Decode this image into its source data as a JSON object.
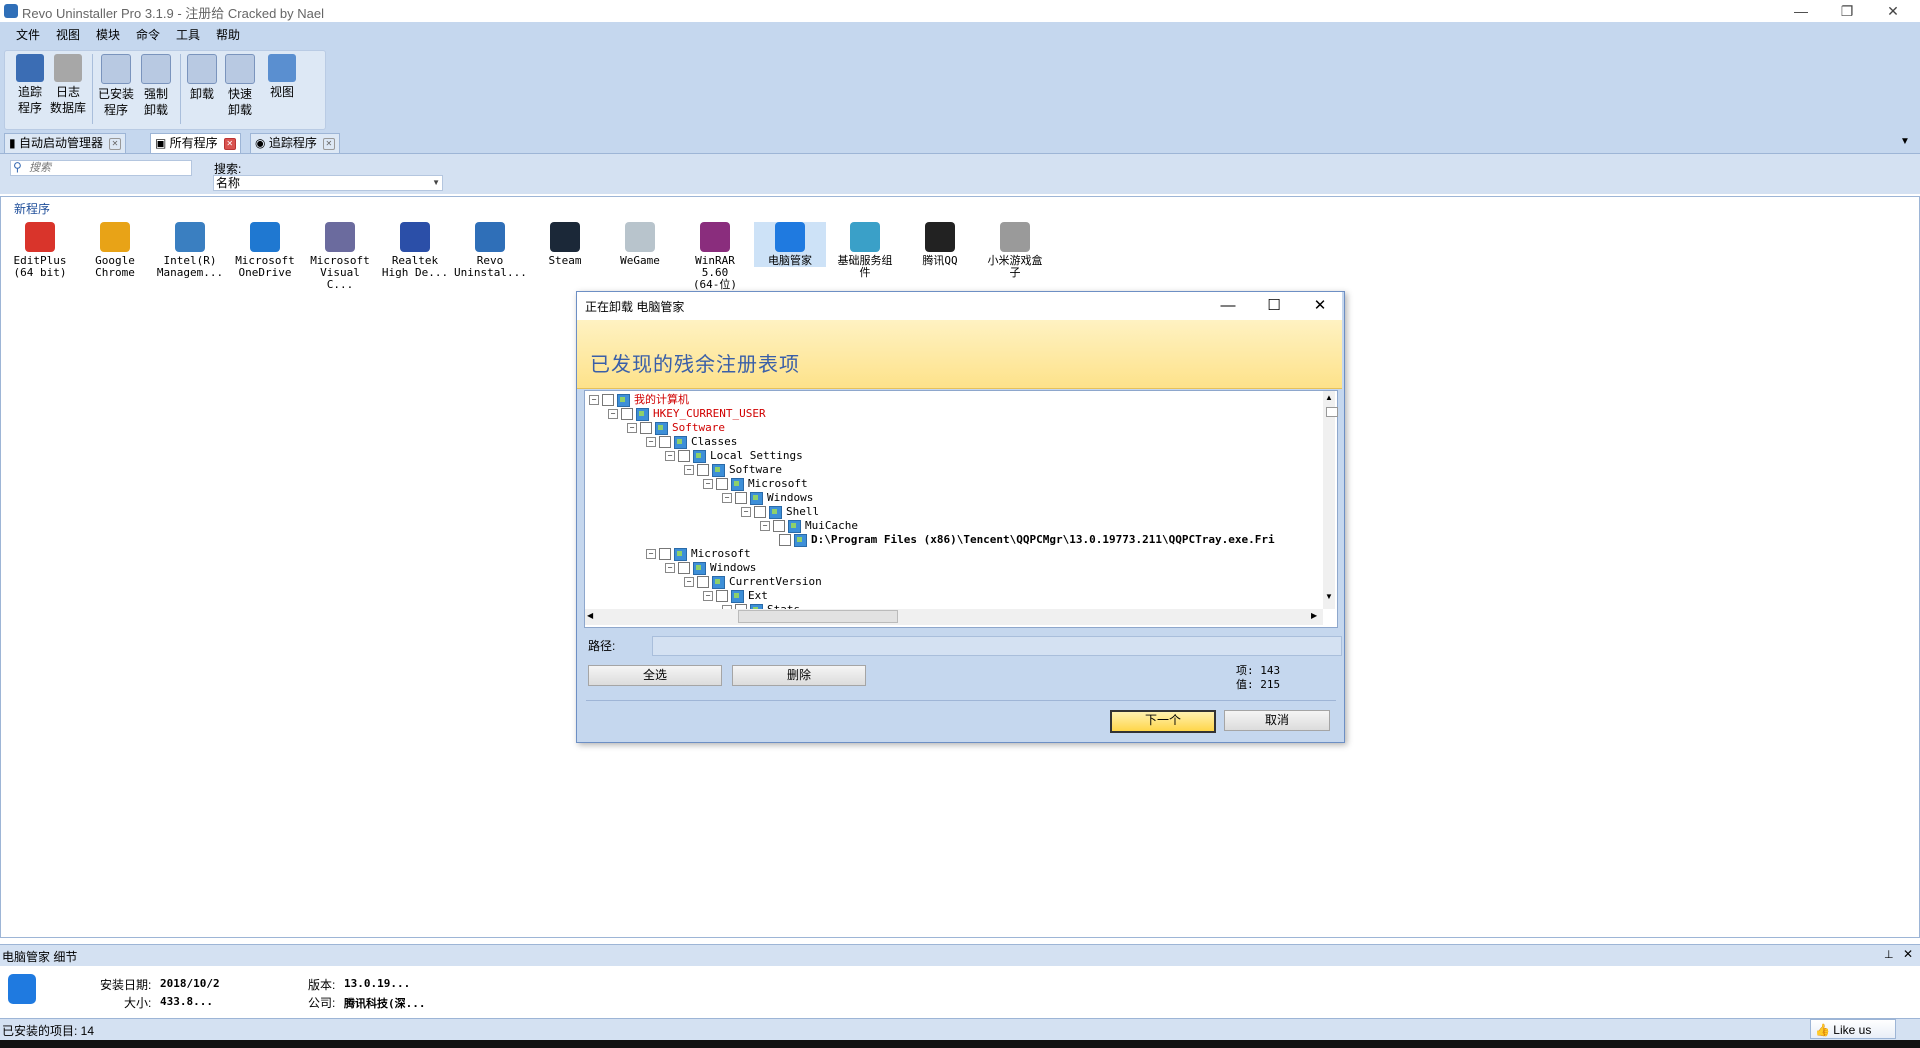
{
  "app": {
    "title": "Revo Uninstaller Pro 3.1.9 - 注册给 Cracked by Nael",
    "controls": {
      "minimize": "—",
      "restore": "❐",
      "close": "✕"
    }
  },
  "menu": [
    "文件",
    "视图",
    "模块",
    "命令",
    "工具",
    "帮助"
  ],
  "ribbon": {
    "buttons": [
      {
        "label1": "追踪",
        "label2": "程序",
        "icon": "hunter-icon"
      },
      {
        "label1": "日志",
        "label2": "数据库",
        "icon": "database-icon"
      },
      {
        "label1": "已安装",
        "label2": "程序",
        "icon": "installed-programs-icon"
      },
      {
        "label1": "强制",
        "label2": "卸载",
        "icon": "forced-uninstall-icon"
      },
      {
        "label1": "卸载",
        "label2": "",
        "icon": "uninstall-icon"
      },
      {
        "label1": "快速",
        "label2": "卸载",
        "icon": "quick-uninstall-icon"
      },
      {
        "label1": "视图",
        "label2": "",
        "icon": "view-icon"
      }
    ]
  },
  "tabs": [
    {
      "label": "自动启动管理器",
      "active": false
    },
    {
      "label": "所有程序",
      "active": true
    },
    {
      "label": "追踪程序",
      "active": false
    }
  ],
  "search": {
    "placeholder": "搜索",
    "label": "搜索:",
    "field": "名称"
  },
  "group": {
    "label": "新程序"
  },
  "apps": [
    {
      "line1": "EditPlus",
      "line2": "(64 bit)",
      "color": "#d9342b"
    },
    {
      "line1": "Google",
      "line2": "Chrome",
      "color": "#e8a317"
    },
    {
      "line1": "Intel(R)",
      "line2": "Managem...",
      "color": "#3a7fc1"
    },
    {
      "line1": "Microsoft",
      "line2": "OneDrive",
      "color": "#1f78d1"
    },
    {
      "line1": "Microsoft",
      "line2": "Visual C...",
      "color": "#6b6b9e"
    },
    {
      "line1": "Realtek",
      "line2": "High De...",
      "color": "#2b4fa8"
    },
    {
      "line1": "Revo",
      "line2": "Uninstal...",
      "color": "#2f6fb8"
    },
    {
      "line1": "Steam",
      "line2": "",
      "color": "#1b2838"
    },
    {
      "line1": "WeGame",
      "line2": "",
      "color": "#b8c4cc"
    },
    {
      "line1": "WinRAR 5.60",
      "line2": "(64-位)",
      "color": "#8a2d7d"
    },
    {
      "line1": "电脑管家",
      "line2": "",
      "color": "#1f7ae0"
    },
    {
      "line1": "基础服务组",
      "line2": "件",
      "color": "#3aa0c8"
    },
    {
      "line1": "腾讯QQ",
      "line2": "",
      "color": "#222222"
    },
    {
      "line1": "小米游戏盒",
      "line2": "子",
      "color": "#9a9a9a"
    }
  ],
  "dialog": {
    "title": "正在卸载 电脑管家",
    "banner": "已发现的残余注册表项",
    "tree": [
      {
        "text": "我的计算机",
        "level": 0,
        "red": true,
        "bold": false
      },
      {
        "text": "HKEY_CURRENT_USER",
        "level": 1,
        "red": true,
        "bold": false
      },
      {
        "text": "Software",
        "level": 2,
        "red": true,
        "bold": false
      },
      {
        "text": "Classes",
        "level": 3,
        "red": false,
        "bold": false
      },
      {
        "text": "Local Settings",
        "level": 4,
        "red": false,
        "bold": false
      },
      {
        "text": "Software",
        "level": 5,
        "red": false,
        "bold": false
      },
      {
        "text": "Microsoft",
        "level": 6,
        "red": false,
        "bold": false
      },
      {
        "text": "Windows",
        "level": 7,
        "red": false,
        "bold": false
      },
      {
        "text": "Shell",
        "level": 8,
        "red": false,
        "bold": false
      },
      {
        "text": "MuiCache",
        "level": 9,
        "red": false,
        "bold": false
      },
      {
        "text": "D:\\Program Files (x86)\\Tencent\\QQPCMgr\\13.0.19773.211\\QQPCTray.exe.Fri",
        "level": 10,
        "red": false,
        "bold": true
      },
      {
        "text": "Microsoft",
        "level": 3,
        "red": false,
        "bold": false
      },
      {
        "text": "Windows",
        "level": 4,
        "red": false,
        "bold": false
      },
      {
        "text": "CurrentVersion",
        "level": 5,
        "red": false,
        "bold": false
      },
      {
        "text": "Ext",
        "level": 6,
        "red": false,
        "bold": false
      },
      {
        "text": "Stats",
        "level": 7,
        "red": false,
        "bold": false
      }
    ],
    "path_label": "路径:",
    "select_all": "全选",
    "delete": "删除",
    "items_label": "项:",
    "items_count": "143",
    "values_label": "值:",
    "values_count": "215",
    "next": "下一个",
    "cancel": "取消"
  },
  "details": {
    "title": "电脑管家 细节",
    "install_date_label": "安装日期:",
    "install_date": "2018/10/2",
    "size_label": "大小:",
    "size": "433.8...",
    "version_label": "版本:",
    "version": "13.0.19...",
    "company_label": "公司:",
    "company": "腾讯科技(深..."
  },
  "status": {
    "installed": "已安装的项目: 14",
    "like": "Like us"
  }
}
